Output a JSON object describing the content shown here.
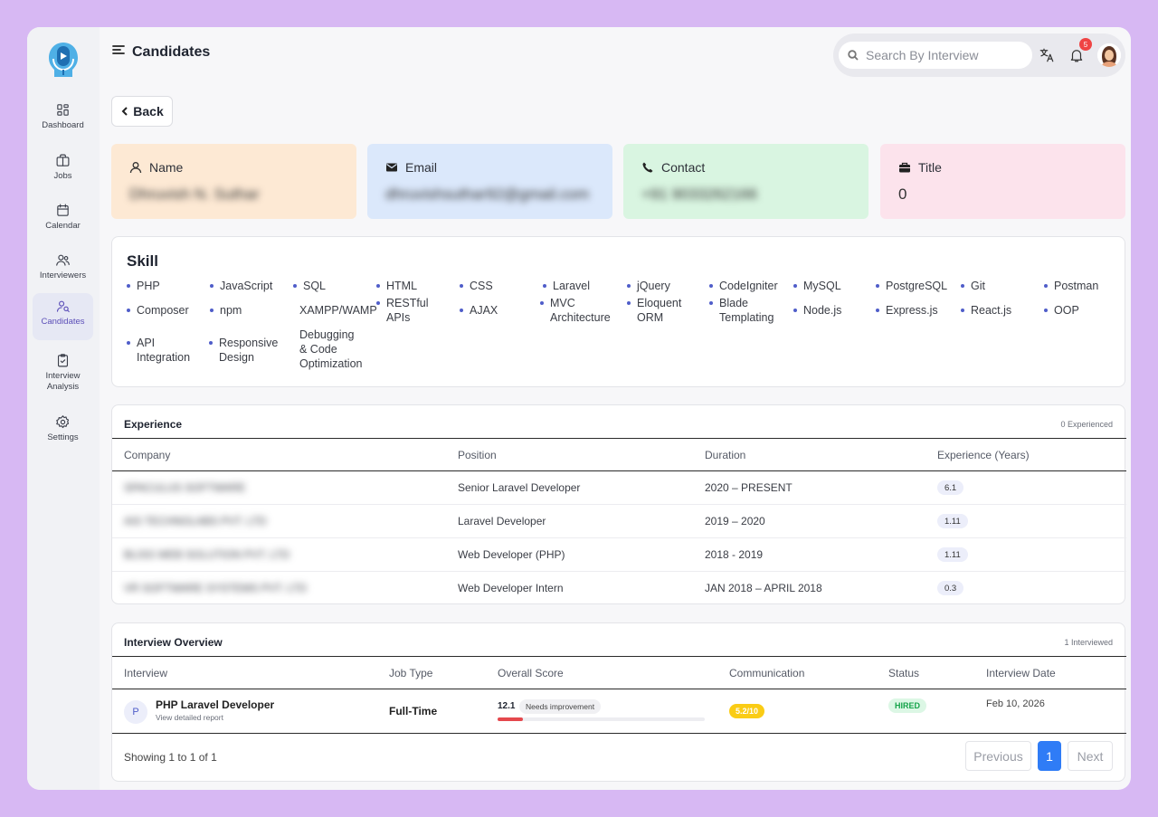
{
  "header": {
    "title": "Candidates",
    "search_placeholder": "Search By Interview",
    "notification_count": "5"
  },
  "sidebar": {
    "items": [
      {
        "label": "Dashboard",
        "icon": "dashboard-icon"
      },
      {
        "label": "Jobs",
        "icon": "briefcase-icon"
      },
      {
        "label": "Calendar",
        "icon": "calendar-icon"
      },
      {
        "label": "Interviewers",
        "icon": "users-icon"
      },
      {
        "label": "Candidates",
        "icon": "user-group-icon",
        "active": true
      },
      {
        "label": "Interview Analysis",
        "icon": "clipboard-check-icon"
      },
      {
        "label": "Settings",
        "icon": "gear-icon"
      }
    ]
  },
  "back_label": "Back",
  "info_cards": {
    "name": {
      "label": "Name",
      "value": "Dhruvish N. Suthar",
      "color": "#fde9d4"
    },
    "email": {
      "label": "Email",
      "value": "dhruvishsuthar92@gmail.com",
      "color": "#dbe8fb"
    },
    "contact": {
      "label": "Contact",
      "value": "+91 9033262166",
      "color": "#d9f5e1"
    },
    "title": {
      "label": "Title",
      "value": "0",
      "color": "#fce3ec"
    }
  },
  "skills": {
    "title": "Skill",
    "items": [
      "PHP",
      "JavaScript",
      "SQL",
      "HTML",
      "CSS",
      "Laravel",
      "jQuery",
      "CodeIgniter",
      "MySQL",
      "PostgreSQL",
      "Git",
      "Postman",
      "Composer",
      "npm",
      "XAMPP/WAMP",
      "RESTful APIs",
      "AJAX",
      "MVC Architecture",
      "Eloquent ORM",
      "Blade Templating",
      "Node.js",
      "Express.js",
      "React.js",
      "OOP",
      "API Integration",
      "Responsive Design",
      "Debugging & Code Optimization"
    ]
  },
  "experience": {
    "title": "Experience",
    "meta": "0 Experienced",
    "columns": [
      "Company",
      "Position",
      "Duration",
      "Experience (Years)"
    ],
    "rows": [
      {
        "company": "SPACULUS SOFTWARE",
        "position": "Senior Laravel Developer",
        "duration": "2020 – PRESENT",
        "years": "6.1"
      },
      {
        "company": "AIS TECHNOLABS PVT. LTD",
        "position": "Laravel Developer",
        "duration": "2019 – 2020",
        "years": "1.11"
      },
      {
        "company": "BLISS WEB SOLUTION PVT. LTD",
        "position": "Web Developer (PHP)",
        "duration": "2018 - 2019",
        "years": "1.11"
      },
      {
        "company": "VR SOFTWARE SYSTEMS PVT. LTD",
        "position": "Web Developer Intern",
        "duration": "JAN 2018 – APRIL 2018",
        "years": "0.3"
      }
    ]
  },
  "interview_overview": {
    "title": "Interview Overview",
    "meta": "1 Interviewed",
    "columns": [
      "Interview",
      "Job Type",
      "Overall Score",
      "Communication",
      "Status",
      "Interview Date"
    ],
    "rows": [
      {
        "avatar_letter": "P",
        "title": "PHP Laravel Developer",
        "subtitle": "View detailed report",
        "job_type": "Full-Time",
        "score": "12.1",
        "score_fraction": 0.121,
        "score_note": "Needs improvement",
        "communication": "5.2/10",
        "status": "HIRED",
        "date": "Feb 10, 2026"
      }
    ],
    "pagination": {
      "summary": "Showing 1 to 1 of 1",
      "previous": "Previous",
      "page": "1",
      "next": "Next"
    }
  },
  "colors": {
    "accent": "#2f7cf6",
    "hired_bg": "#dcf7e5",
    "hired_text": "#16a34a",
    "comm_bg": "#facc15",
    "score_bar": "#e5484d"
  }
}
